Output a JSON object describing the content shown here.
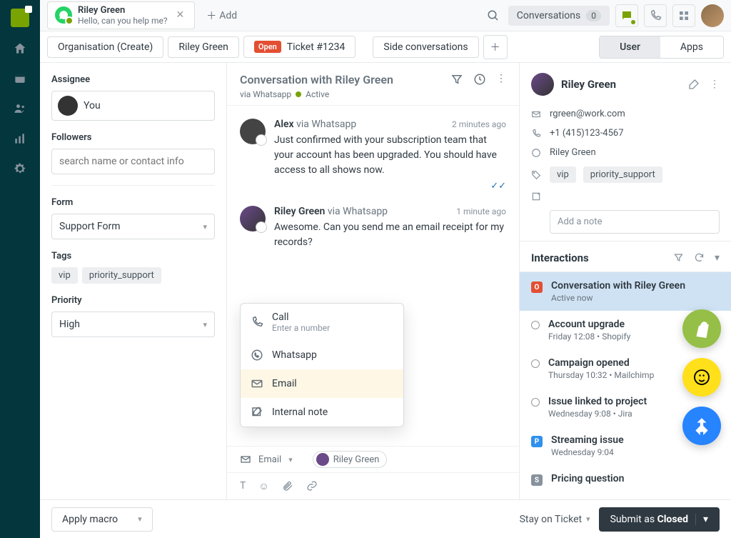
{
  "topTab": {
    "title": "Riley Green",
    "subtitle": "Hello, can you help me?",
    "addLabel": "Add"
  },
  "topbar": {
    "conversations": "Conversations",
    "convCount": "0"
  },
  "context": {
    "crumb1": "Organisation (Create)",
    "crumb2": "Riley Green",
    "ticketBadge": "Open",
    "ticketLabel": "Ticket #1234",
    "sideConv": "Side conversations",
    "segUser": "User",
    "segApps": "Apps"
  },
  "sidebar": {
    "assigneeLabel": "Assignee",
    "assigneeName": "You",
    "followersLabel": "Followers",
    "followersPlaceholder": "search name or contact info",
    "formLabel": "Form",
    "formValue": "Support Form",
    "tagsLabel": "Tags",
    "tags": [
      "vip",
      "priority_support"
    ],
    "priorityLabel": "Priority",
    "priorityValue": "High"
  },
  "conversation": {
    "title": "Conversation with Riley Green",
    "via": "via Whatsapp",
    "status": "Active",
    "messages": [
      {
        "sender": "Alex",
        "via": "via Whatsapp",
        "time": "2 minutes ago",
        "text": "Just confirmed with your subscription team that your account has been upgraded. You should have access to all shows now."
      },
      {
        "sender": "Riley Green",
        "via": "via Whatsapp",
        "time": "1 minute ago",
        "text": "Awesome. Can you send me an email receipt for my records?"
      }
    ],
    "channelMenu": {
      "callLabel": "Call",
      "callSub": "Enter a number",
      "whatsapp": "Whatsapp",
      "email": "Email",
      "note": "Internal note"
    },
    "composer": {
      "channel": "Email",
      "recipient": "Riley Green"
    }
  },
  "rightPanel": {
    "name": "Riley Green",
    "email": "rgreen@work.com",
    "phone": "+1 (415)123-4567",
    "whatsapp": "Riley Green",
    "tags": [
      "vip",
      "priority_support"
    ],
    "notePlaceholder": "Add a note",
    "interactionsTitle": "Interactions",
    "interactions": [
      {
        "title": "Conversation with Riley Green",
        "sub": "Active now"
      },
      {
        "title": "Account upgrade",
        "sub": "Friday 12:08 • Shopify"
      },
      {
        "title": "Campaign opened",
        "sub": "Thursday 10:32 • Mailchimp"
      },
      {
        "title": "Issue linked to project",
        "sub": "Wednesday 9:08 • Jira"
      },
      {
        "title": "Streaming issue",
        "sub": "Wednesday 9:04"
      },
      {
        "title": "Pricing question",
        "sub": ""
      }
    ]
  },
  "footer": {
    "macro": "Apply macro",
    "stay": "Stay on Ticket",
    "submitPrefix": "Submit as ",
    "submitStatus": "Closed"
  }
}
